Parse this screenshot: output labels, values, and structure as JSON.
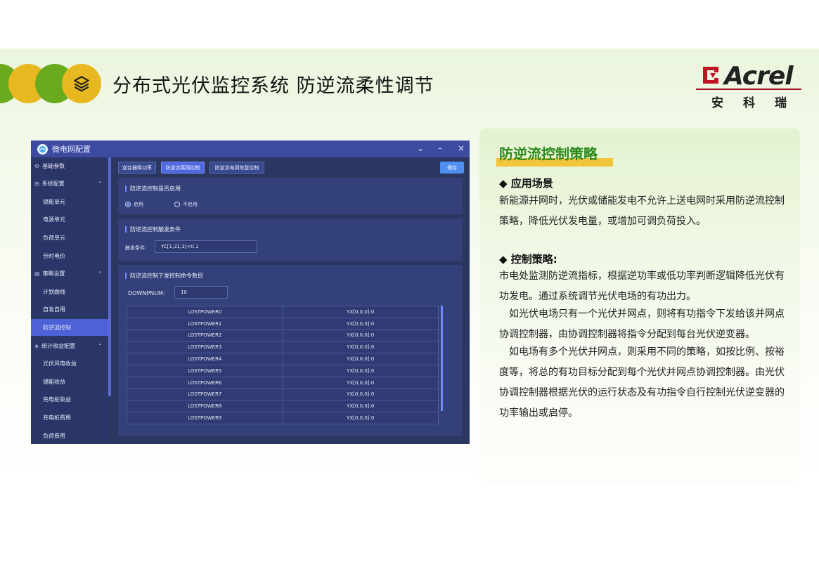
{
  "slide": {
    "title": "分布式光伏监控系统  防逆流柔性调节"
  },
  "logo": {
    "brand": "Acrel",
    "cn": "安科瑞"
  },
  "app": {
    "title": "微电网配置",
    "controls": {
      "collapse": "⌄",
      "minimize": "–",
      "close": "×"
    },
    "sidebar": {
      "items": [
        {
          "label": "基础参数",
          "type": "group",
          "icon": "gear-icon"
        },
        {
          "label": "系统配置",
          "type": "group",
          "icon": "network-icon",
          "expanded": true
        },
        {
          "label": "储能单元",
          "type": "sub"
        },
        {
          "label": "电源单元",
          "type": "sub"
        },
        {
          "label": "负荷单元",
          "type": "sub"
        },
        {
          "label": "分时电价",
          "type": "sub"
        },
        {
          "label": "策略设置",
          "type": "group",
          "icon": "strategy-icon",
          "expanded": true
        },
        {
          "label": "计划曲线",
          "type": "sub"
        },
        {
          "label": "自发自用",
          "type": "sub"
        },
        {
          "label": "防逆流控制",
          "type": "sub",
          "active": true
        },
        {
          "label": "统计收益配置",
          "type": "group",
          "icon": "stats-icon",
          "expanded": true
        },
        {
          "label": "光伏风电收益",
          "type": "sub"
        },
        {
          "label": "储能收益",
          "type": "sub"
        },
        {
          "label": "充电桩收益",
          "type": "sub"
        },
        {
          "label": "充电桩费用",
          "type": "sub"
        },
        {
          "label": "负荷费用",
          "type": "sub"
        }
      ]
    },
    "tabs": [
      {
        "label": "逆变器降功率",
        "active": false
      },
      {
        "label": "防逆流离网控制",
        "active": true
      },
      {
        "label": "防逆流电网恢复控制",
        "active": false
      }
    ],
    "save_label": "保存",
    "enable_panel": {
      "title": "防逆流控制是否启用",
      "options": [
        {
          "label": "启用",
          "selected": true
        },
        {
          "label": "不启用",
          "selected": false
        }
      ]
    },
    "trigger_panel": {
      "title": "防逆流控制触发条件",
      "label": "触发条件:",
      "value": "YC[1,31,3]<0.1"
    },
    "command_panel": {
      "title": "防逆流控制下发控制命令数目",
      "label": "DOWNPNUM:",
      "value": "10",
      "rows": [
        [
          "LOSTPOWER0",
          "YX[0,0,0]:0"
        ],
        [
          "LOSTPOWER1",
          "YX[0,0,0]:0"
        ],
        [
          "LOSTPOWER2",
          "YX[0,0,0]:0"
        ],
        [
          "LOSTPOWER3",
          "YX[0,0,0]:0"
        ],
        [
          "LOSTPOWER4",
          "YX[0,0,0]:0"
        ],
        [
          "LOSTPOWER5",
          "YX[0,0,0]:0"
        ],
        [
          "LOSTPOWER6",
          "YX[0,0,0]:0"
        ],
        [
          "LOSTPOWER7",
          "YX[0,0,0]:0"
        ],
        [
          "LOSTPOWER8",
          "YX[0,0,0]:0"
        ],
        [
          "LOSTPOWER9",
          "YX[0,0,0]:0"
        ]
      ]
    }
  },
  "card": {
    "title": "防逆流控制策略",
    "section1_heading": "◆  应用场景",
    "section1_text": "新能源并网时，光伏或储能发电不允许上送电网时采用防逆流控制策略，降低光伏发电量，或增加可调负荷投入。",
    "section2_heading": "◆  控制策略:",
    "section2_p1": "市电处监测防逆流指标，根据逆功率或低功率判断逻辑降低光伏有功发电。通过系统调节光伏电场的有功出力。",
    "section2_p2": "如光伏电场只有一个光伏并网点，则将有功指令下发给该并网点协调控制器，由协调控制器将指令分配到每台光伏逆变器。",
    "section2_p3": "如电场有多个光伏并网点，则采用不同的策略，如按比例、按裕度等，将总的有功目标分配到每个光伏并网点协调控制器。由光伏协调控制器根据光伏的运行状态及有功指令自行控制光伏逆变器的功率输出或启停。"
  },
  "colors": {
    "green": "#6aaa1e",
    "yellow": "#e8b820",
    "app_bg": "#2b3760",
    "accent_blue": "#4f6ae0",
    "card_title": "#2a8a1a"
  }
}
